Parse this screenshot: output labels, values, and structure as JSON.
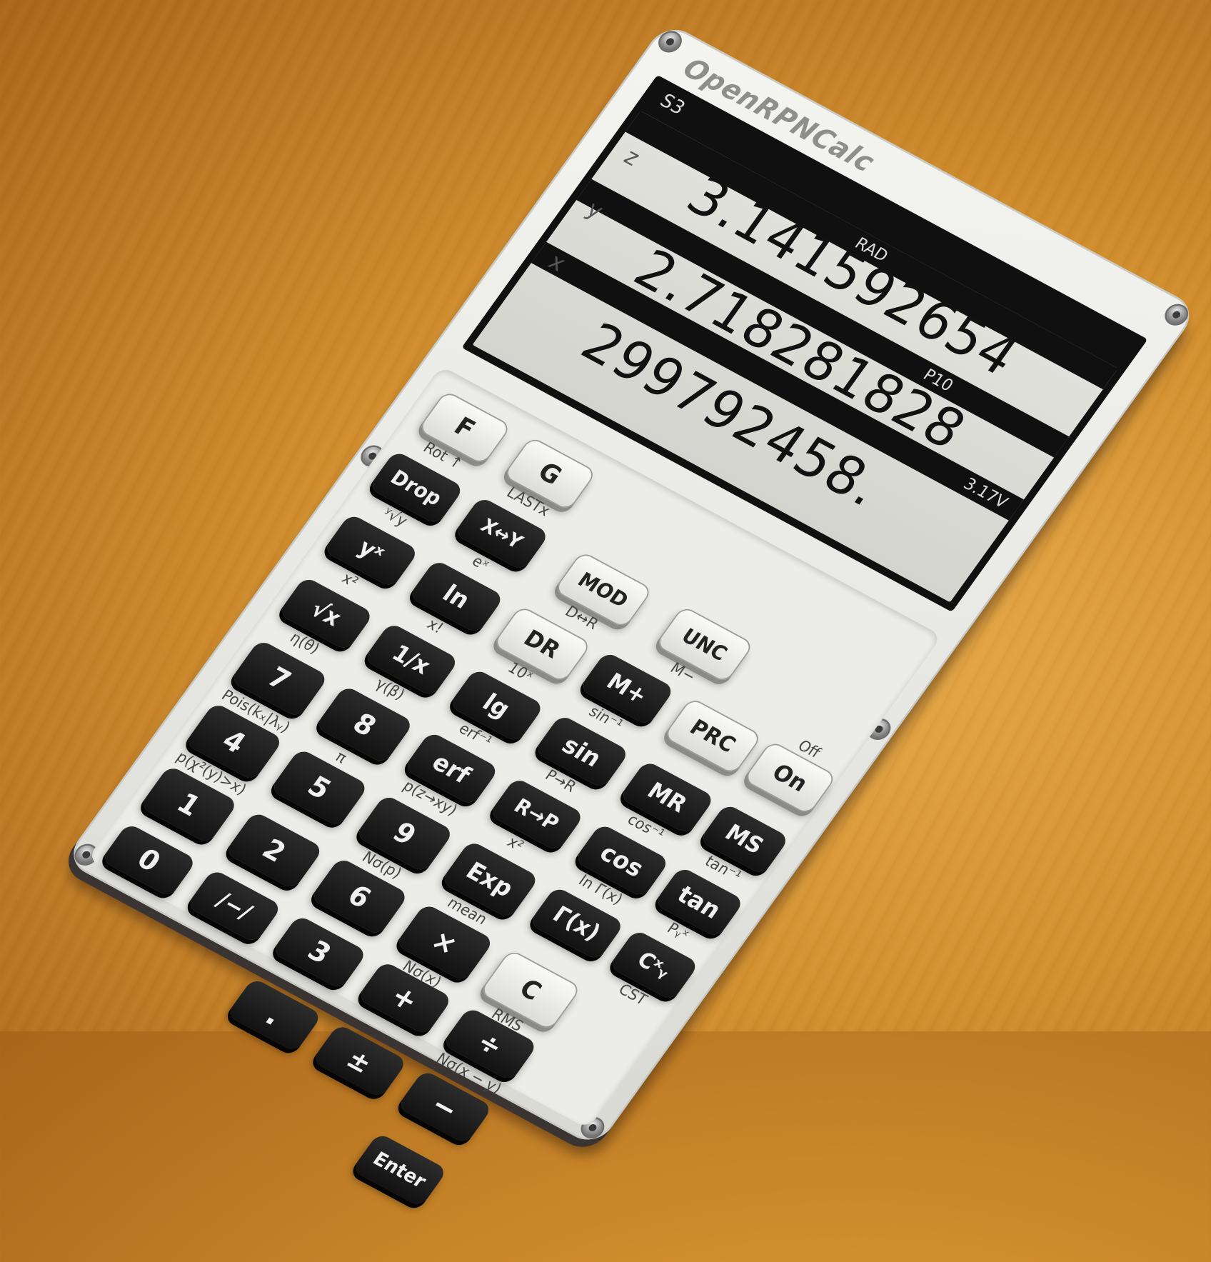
{
  "brand": "OpenRPNCalc",
  "status": {
    "stack_size": "S3",
    "angle_mode": "RAD",
    "precision": "P10",
    "battery": "3.17V"
  },
  "registers": [
    {
      "label": "z",
      "value": "3.141592654"
    },
    {
      "label": "y",
      "value": "2.718281828"
    },
    {
      "label": "x",
      "value": "299792458."
    }
  ],
  "keys": {
    "f": "F",
    "g": "G",
    "drop": "Drop",
    "swap": "X↔Y",
    "mod": "MOD",
    "unc": "UNC",
    "pow": "yˣ",
    "ln": "ln",
    "dr": "DR",
    "mplus": "M+",
    "prc": "PRC",
    "on": "On",
    "sqrt": "√x",
    "inv": "1/x",
    "lg": "lg",
    "sin": "sin",
    "mr": "MR",
    "ms": "MS",
    "seven": "7",
    "erf": "erf",
    "rp": "R→P",
    "cos": "cos",
    "tan": "tan",
    "four": "4",
    "eight": "8",
    "nine": "9",
    "gamma": "Γ(x)",
    "cxy": "Cˣᵧ",
    "one": "1",
    "five": "5",
    "exp": "Exp",
    "c": "C",
    "zero": "0",
    "two": "2",
    "six": "6",
    "mul": "×",
    "frac": "/−/",
    "three": "3",
    "div": "÷",
    "dot": ".",
    "plus": "+",
    "minus": "−",
    "pm": "±",
    "enter": "Enter"
  },
  "shift_labels": {
    "f": "Rot ↑",
    "g": "LASTx",
    "drop": "ʸ√y",
    "mod": "D↔R",
    "swap": "eˣ",
    "pow": "x²",
    "dr": "10ˣ",
    "unc": "M−",
    "on": "Off",
    "ln": "x!",
    "mplus": "sin⁻¹",
    "sqrt": "η(θ)",
    "lg": "erf⁻¹",
    "mr": "cos⁻¹",
    "inv": "γ(β)",
    "sin": "P→R",
    "ms": "tan⁻¹",
    "seven": "Pois(kₓ|λᵧ)",
    "erf": "p(z→xy)",
    "cos": "ln Γ(x)",
    "four": "p(χ²(y)>x)",
    "tan": "Pᵧˣ",
    "rp": "x²",
    "eight": "π",
    "nine": "Nσ(p)",
    "cxy": "CST",
    "exp": "mean",
    "c": "RMS",
    "mul": "Nσ(x)",
    "div": "Nσ(x − y)"
  }
}
